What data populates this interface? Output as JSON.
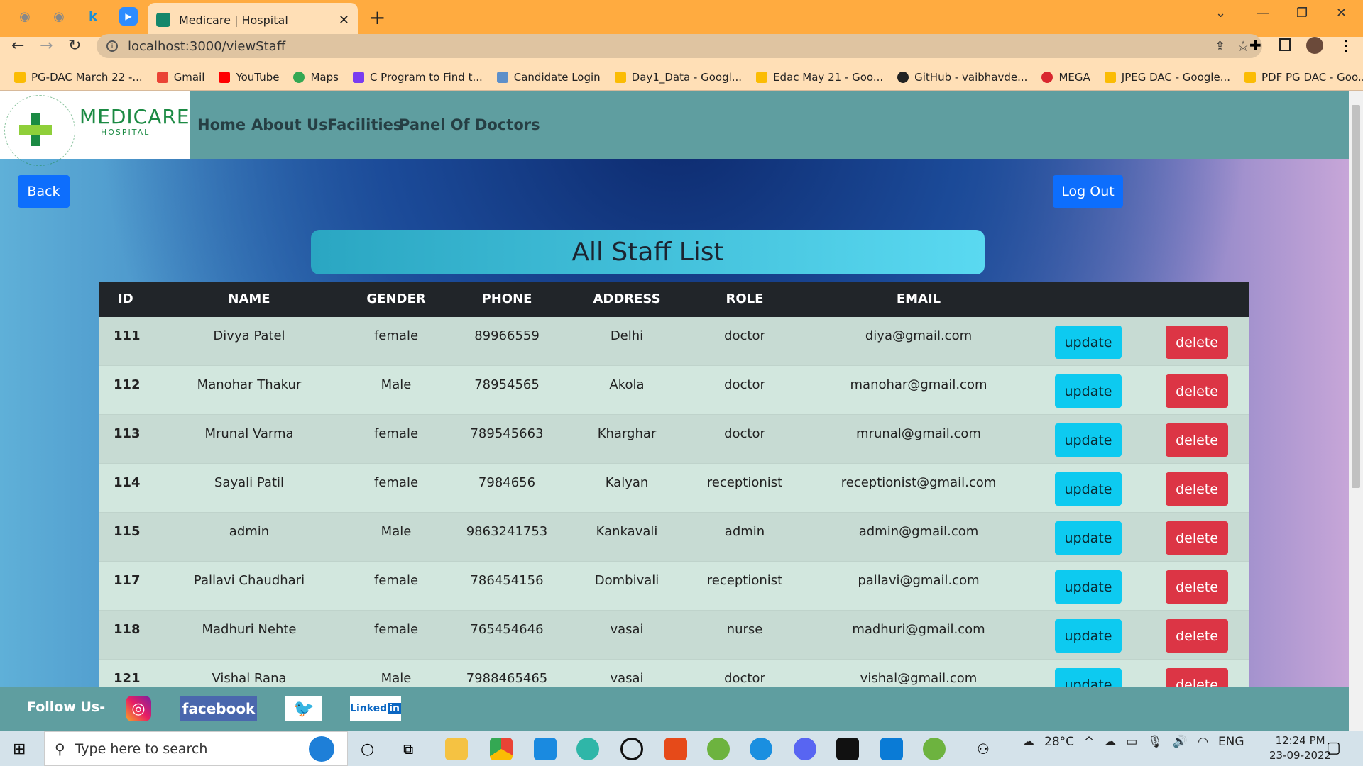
{
  "browser": {
    "tab_title": "Medicare | Hospital",
    "url": "localhost:3000/viewStaff",
    "bookmarks": [
      "PG-DAC March 22 -...",
      "Gmail",
      "YouTube",
      "Maps",
      "C Program to Find t...",
      "Candidate Login",
      "Day1_Data - Googl...",
      "Edac May 21 - Goo...",
      "GitHub - vaibhavde...",
      "MEGA",
      "JPEG DAC - Google...",
      "PDF PG DAC - Goo..."
    ]
  },
  "logo": {
    "name": "MEDICARE",
    "sub": "HOSPITAL",
    "ring_text": "HEALING HANDS CARING HEARTS"
  },
  "nav": {
    "items": [
      "Home",
      "About Us",
      "Facilities",
      "Panel Of Doctors"
    ]
  },
  "buttons": {
    "back": "Back",
    "logout": "Log Out",
    "update": "update",
    "delete": "delete"
  },
  "title": "All Staff List",
  "table": {
    "headers": [
      "ID",
      "NAME",
      "GENDER",
      "PHONE",
      "ADDRESS",
      "ROLE",
      "EMAIL"
    ],
    "rows": [
      [
        "111",
        "Divya Patel",
        "female",
        "89966559",
        "Delhi",
        "doctor",
        "diya@gmail.com"
      ],
      [
        "112",
        "Manohar Thakur",
        "Male",
        "78954565",
        "Akola",
        "doctor",
        "manohar@gmail.com"
      ],
      [
        "113",
        "Mrunal Varma",
        "female",
        "789545663",
        "Kharghar",
        "doctor",
        "mrunal@gmail.com"
      ],
      [
        "114",
        "Sayali Patil",
        "female",
        "7984656",
        "Kalyan",
        "receptionist",
        "receptionist@gmail.com"
      ],
      [
        "115",
        "admin",
        "Male",
        "9863241753",
        "Kankavali",
        "admin",
        "admin@gmail.com"
      ],
      [
        "117",
        "Pallavi Chaudhari",
        "female",
        "786454156",
        "Dombivali",
        "receptionist",
        "pallavi@gmail.com"
      ],
      [
        "118",
        "Madhuri Nehte",
        "female",
        "765454646",
        "vasai",
        "nurse",
        "madhuri@gmail.com"
      ],
      [
        "121",
        "Vishal Rana",
        "Male",
        "7988465465",
        "vasai",
        "doctor",
        "vishal@gmail.com"
      ]
    ]
  },
  "footer": {
    "follow": "Follow Us-",
    "facebook": "facebook",
    "linkedin": "Linked",
    "linkedin_in": "in"
  },
  "taskbar": {
    "search_placeholder": "Type here to search",
    "temp": "28°C",
    "lang": "ENG",
    "time": "12:24 PM",
    "date": "23-09-2022"
  },
  "colors": {
    "navbar": "#5f9ea0",
    "tabbar": "#ffab40",
    "primary": "#0d6efd",
    "info": "#0dcaf0",
    "danger": "#dc3545",
    "table_header": "#212529"
  }
}
